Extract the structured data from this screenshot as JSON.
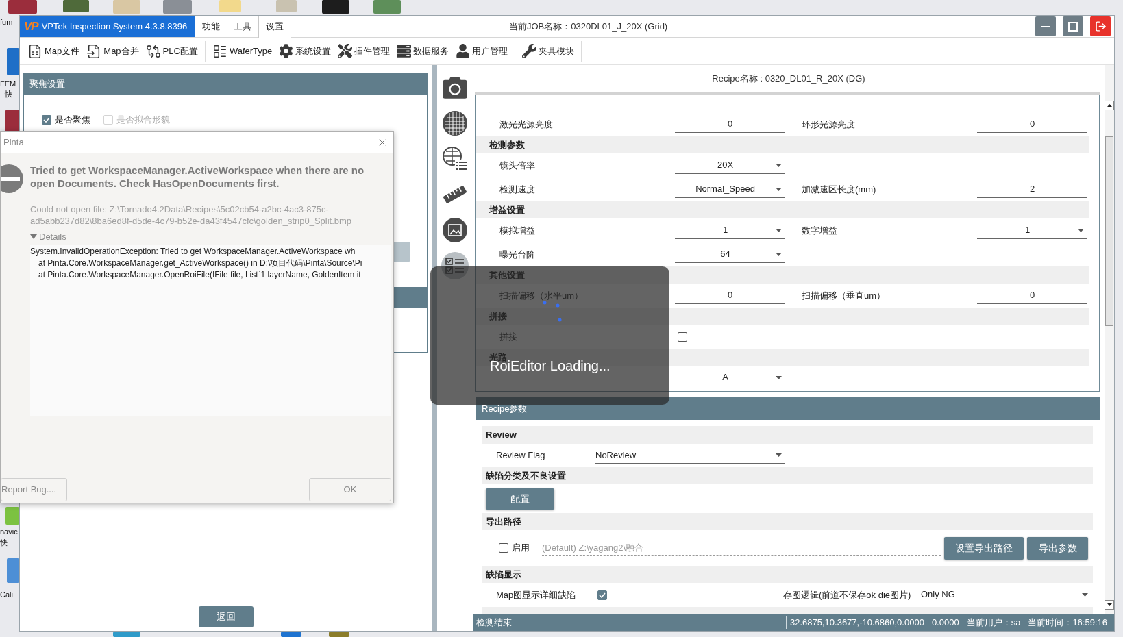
{
  "desktop": {
    "labels": [
      "fum",
      "FEM",
      "- 快",
      "navic",
      "快",
      "Cali"
    ]
  },
  "window": {
    "logo": "VP",
    "title": "VPTek Inspection System 4.3.8.8396",
    "menu_tabs": [
      {
        "label": "功能",
        "selected": false
      },
      {
        "label": "工具",
        "selected": false
      },
      {
        "label": "设置",
        "selected": true
      }
    ],
    "job": "当前JOB名称：0320DL01_J_20X (Grid)"
  },
  "toolbar": {
    "groups": [
      [
        "Map文件",
        "Map合并",
        "PLC配置"
      ],
      [
        "WaferType",
        "系统设置",
        "插件管理",
        "数据服务",
        "用户管理"
      ],
      [
        "夹具模块"
      ]
    ]
  },
  "focus_panel": {
    "title": "聚焦设置",
    "options": [
      {
        "label": "是否聚焦",
        "checked": true,
        "disabled": false
      },
      {
        "label": "是否拟合形貌",
        "checked": false,
        "disabled": true
      }
    ],
    "back_button": "返回"
  },
  "recipe": {
    "name": "Recipe名称 : 0320_DL01_R_20X (DG)",
    "rows": [
      {
        "kind": "fields",
        "fields": [
          {
            "label": "激光光源亮度",
            "kind": "input",
            "value": "0"
          },
          {
            "label": "环形光源亮度",
            "kind": "input",
            "value": "0"
          }
        ]
      },
      {
        "kind": "section",
        "title": "检测参数"
      },
      {
        "kind": "fields",
        "fields": [
          {
            "label": "镜头倍率",
            "kind": "select",
            "value": "20X"
          }
        ]
      },
      {
        "kind": "fields",
        "fields": [
          {
            "label": "检测速度",
            "kind": "select",
            "value": "Normal_Speed"
          },
          {
            "label": "加减速区长度(mm)",
            "kind": "input",
            "value": "2"
          }
        ]
      },
      {
        "kind": "section",
        "title": "增益设置"
      },
      {
        "kind": "fields",
        "fields": [
          {
            "label": "模拟增益",
            "kind": "select",
            "value": "1"
          },
          {
            "label": "数字增益",
            "kind": "select",
            "value": "1"
          }
        ]
      },
      {
        "kind": "fields",
        "fields": [
          {
            "label": "曝光台阶",
            "kind": "select",
            "value": "64"
          }
        ]
      },
      {
        "kind": "section",
        "title": "其他设置"
      },
      {
        "kind": "fields",
        "fields": [
          {
            "label": "扫描偏移（水平um）",
            "kind": "input",
            "value": "0"
          },
          {
            "label": "扫描偏移（垂直um）",
            "kind": "input",
            "value": "0"
          }
        ]
      },
      {
        "kind": "section",
        "title": "拼接"
      },
      {
        "kind": "fields",
        "fields": [
          {
            "label": "拼接",
            "kind": "checkbox",
            "checked": false
          }
        ]
      },
      {
        "kind": "section",
        "title": "光路"
      },
      {
        "kind": "fields",
        "fields": [
          {
            "kind": "select",
            "value": "A"
          }
        ]
      }
    ]
  },
  "recipe_params": {
    "title": "Recipe参数",
    "sections": [
      {
        "title": "Review",
        "rows": [
          {
            "kind": "select",
            "label": "Review Flag",
            "value": "NoReview"
          }
        ]
      },
      {
        "title": "缺陷分类及不良设置",
        "rows": [
          {
            "kind": "button",
            "label": "配置"
          }
        ]
      },
      {
        "title": "导出路径",
        "rows": [
          {
            "kind": "path",
            "checkbox_label": "启用",
            "checked": false,
            "placeholder": "(Default) Z:\\yagang2\\融合",
            "buttons": [
              "设置导出路径",
              "导出参数"
            ]
          }
        ]
      },
      {
        "title": "缺陷显示",
        "rows": [
          {
            "kind": "check_select",
            "label": "Map图显示详细缺陷",
            "checked": true,
            "label_2": "存图逻辑(前道不保存ok die图片)",
            "value": "Only NG"
          }
        ]
      }
    ]
  },
  "status_bar": {
    "message": "检测结束",
    "fields": [
      "32.6875,10.3677,-10.6860,0.0000",
      "0.0000",
      "当前用户：sa",
      "当前时间：16:59:16"
    ]
  },
  "loading": {
    "text": "RoiEditor Loading..."
  },
  "dialog": {
    "title": "Pinta",
    "heading": "Tried to get WorkspaceManager.ActiveWorkspace when there are no open Documents.  Check HasOpenDocuments first.",
    "message": "Could not open file: Z:\\Tornado4.2Data\\Recipes\\5c02cb54-a2bc-4ac3-875c-ad5abb237d82\\8ba6ed8f-d5de-4c79-b52e-da43f4547cfc\\golden_strip0_Split.bmp",
    "details_label": "Details",
    "details_expanded": true,
    "details_lines": [
      "System.InvalidOperationException: Tried to get WorkspaceManager.ActiveWorkspace wh",
      "at Pinta.Core.WorkspaceManager.get_ActiveWorkspace() in D:\\项目代码\\Pinta\\Source\\Pi",
      "at Pinta.Core.WorkspaceManager.OpenRoiFile(IFile file, List`1 layerName, GoldenItem it"
    ],
    "buttons": [
      "Report Bug....",
      "OK"
    ]
  }
}
